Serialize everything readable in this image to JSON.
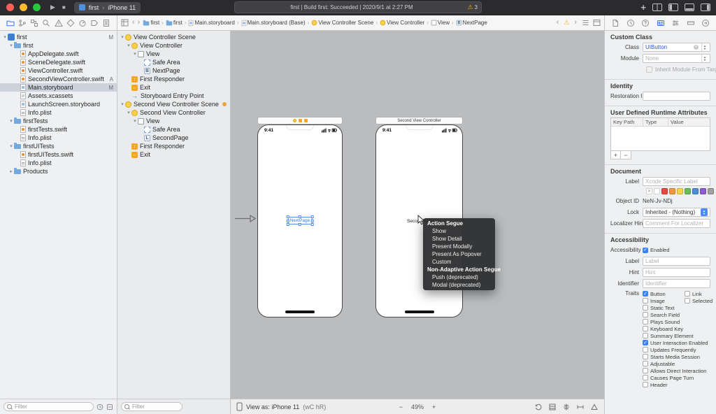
{
  "titlebar": {
    "scheme_name": "first",
    "device_name": "iPhone 11",
    "status_text": "first | Build first: Succeeded | 2020/9/1 at 2:27 PM",
    "warning_count": "3"
  },
  "jumpbar": {
    "crumbs": [
      {
        "label": "first",
        "icon": "folder"
      },
      {
        "label": "first",
        "icon": "folder"
      },
      {
        "label": "Main.storyboard",
        "icon": "storyboard"
      },
      {
        "label": "Main.storyboard (Base)",
        "icon": "storyboard"
      },
      {
        "label": "View Controller Scene",
        "icon": "scene"
      },
      {
        "label": "View Controller",
        "icon": "vc"
      },
      {
        "label": "View",
        "icon": "view"
      },
      {
        "label": "NextPage",
        "icon": "badge-b"
      }
    ]
  },
  "navigator": {
    "filter_placeholder": "Filter",
    "items": [
      {
        "label": "first",
        "icon": "project",
        "level": 0,
        "disclosure": "open",
        "badge": "M"
      },
      {
        "label": "first",
        "icon": "folder",
        "level": 1,
        "disclosure": "open"
      },
      {
        "label": "AppDelegate.swift",
        "icon": "swift",
        "level": 2
      },
      {
        "label": "SceneDelegate.swift",
        "icon": "swift",
        "level": 2
      },
      {
        "label": "ViewController.swift",
        "icon": "swift",
        "level": 2
      },
      {
        "label": "SecondViewController.swift",
        "icon": "swift",
        "level": 2,
        "badge": "A"
      },
      {
        "label": "Main.storyboard",
        "icon": "storyboard",
        "level": 2,
        "badge": "M",
        "selected": true
      },
      {
        "label": "Assets.xcassets",
        "icon": "assets",
        "level": 2
      },
      {
        "label": "LaunchScreen.storyboard",
        "icon": "storyboard",
        "level": 2
      },
      {
        "label": "Info.plist",
        "icon": "plist",
        "level": 2
      },
      {
        "label": "firstTests",
        "icon": "folder",
        "level": 1,
        "disclosure": "open"
      },
      {
        "label": "firstTests.swift",
        "icon": "swift",
        "level": 2
      },
      {
        "label": "Info.plist",
        "icon": "plist",
        "level": 2
      },
      {
        "label": "firstUITests",
        "icon": "folder",
        "level": 1,
        "disclosure": "open"
      },
      {
        "label": "firstUITests.swift",
        "icon": "swift",
        "level": 2
      },
      {
        "label": "Info.plist",
        "icon": "plist",
        "level": 2
      },
      {
        "label": "Products",
        "icon": "folder",
        "level": 1,
        "disclosure": "closed"
      }
    ]
  },
  "outline": {
    "filter_placeholder": "Filter",
    "items": [
      {
        "label": "View Controller Scene",
        "icon": "scene",
        "level": 0,
        "disclosure": "open"
      },
      {
        "label": "View Controller",
        "icon": "vc",
        "level": 1,
        "disclosure": "open"
      },
      {
        "label": "View",
        "icon": "view",
        "level": 2,
        "disclosure": "open"
      },
      {
        "label": "Safe Area",
        "icon": "safearea",
        "level": 3
      },
      {
        "label": "NextPage",
        "icon": "badge-b",
        "level": 3
      },
      {
        "label": "First Responder",
        "icon": "responder",
        "level": 1
      },
      {
        "label": "Exit",
        "icon": "exit",
        "level": 1
      },
      {
        "label": "Storyboard Entry Point",
        "icon": "entry",
        "level": 1
      },
      {
        "label": "Second View Controller Scene",
        "icon": "scene",
        "level": 0,
        "disclosure": "open",
        "trailing": "dot"
      },
      {
        "label": "Second View Controller",
        "icon": "vc",
        "level": 1,
        "disclosure": "open"
      },
      {
        "label": "View",
        "icon": "view",
        "level": 2,
        "disclosure": "open"
      },
      {
        "label": "Safe Area",
        "icon": "safearea",
        "level": 3
      },
      {
        "label": "SecondPage",
        "icon": "badge-l",
        "level": 3
      },
      {
        "label": "First Responder",
        "icon": "responder",
        "level": 1
      },
      {
        "label": "Exit",
        "icon": "exit",
        "level": 1
      }
    ]
  },
  "canvas": {
    "vc1": {
      "time": "9:41",
      "button_label": "NextPage"
    },
    "vc2": {
      "dock_title": "Second View Controller",
      "time": "9:41",
      "label_text": "SecondPage"
    },
    "segue_menu": {
      "sections": [
        {
          "header": "Action Segue",
          "items": [
            "Show",
            "Show Detail",
            "Present Modally",
            "Present As Popover",
            "Custom"
          ]
        },
        {
          "header": "Non-Adaptive Action Segue",
          "items": [
            "Push (deprecated)",
            "Modal (deprecated)"
          ]
        }
      ]
    },
    "bottom": {
      "view_as": "View as: iPhone 11",
      "traits": "(wC hR)",
      "zoom_out": "−",
      "zoom": "49%",
      "zoom_in": "+"
    }
  },
  "inspector": {
    "custom_class": {
      "title": "Custom Class",
      "class_label": "Class",
      "class_value": "UIButton",
      "module_label": "Module",
      "module_value": "None",
      "inherit_label": "Inherit Module From Target"
    },
    "identity": {
      "title": "Identity",
      "restoration_label": "Restoration ID"
    },
    "runtime_attrs": {
      "title": "User Defined Runtime Attributes",
      "columns": [
        "Key Path",
        "Type",
        "Value"
      ],
      "add": "+",
      "remove": "−"
    },
    "document": {
      "title": "Document",
      "label_label": "Label",
      "label_placeholder": "Xcode Specific Label",
      "object_id_label": "Object ID",
      "object_id_value": "NeN-Jv-NDj",
      "lock_label": "Lock",
      "lock_value": "Inherited - (Nothing)",
      "localizer_label": "Localizer Hint",
      "localizer_placeholder": "Comment For Localizer",
      "swatches": [
        "none",
        "#ffffff",
        "#e5493f",
        "#f0983f",
        "#f7d44b",
        "#69bd58",
        "#4a90d9",
        "#8e5bd4",
        "#a0a0a0"
      ]
    },
    "accessibility": {
      "title": "Accessibility",
      "enabled_row_label": "Accessibility",
      "enabled_label": "Enabled",
      "label_label": "Label",
      "label_placeholder": "Label",
      "hint_label": "Hint",
      "hint_placeholder": "Hint",
      "identifier_label": "Identifier",
      "identifier_placeholder": "Identifier",
      "traits_label": "Traits",
      "traits_col1": [
        {
          "label": "Button",
          "checked": true
        },
        {
          "label": "Image",
          "checked": false
        },
        {
          "label": "Static Text",
          "checked": false
        },
        {
          "label": "Search Field",
          "checked": false
        },
        {
          "label": "Plays Sound",
          "checked": false
        },
        {
          "label": "Keyboard Key",
          "checked": false
        },
        {
          "label": "Summary Element",
          "checked": false
        },
        {
          "label": "User Interaction Enabled",
          "checked": true
        },
        {
          "label": "Updates Frequently",
          "checked": false
        },
        {
          "label": "Starts Media Session",
          "checked": false
        },
        {
          "label": "Adjustable",
          "checked": false
        },
        {
          "label": "Allows Direct Interaction",
          "checked": false
        },
        {
          "label": "Causes Page Turn",
          "checked": false
        },
        {
          "label": "Header",
          "checked": false
        }
      ],
      "traits_col2": [
        {
          "label": "Link",
          "checked": false
        },
        {
          "label": "Selected",
          "checked": false
        }
      ]
    }
  }
}
